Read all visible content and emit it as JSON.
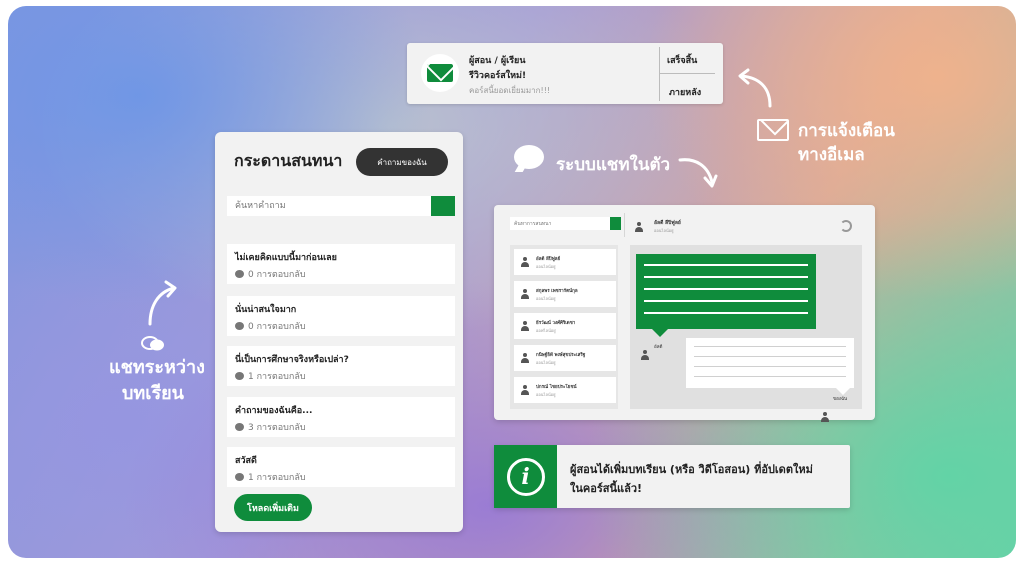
{
  "notification": {
    "from": "ผู้สอน / ผู้เรียน",
    "subject": "รีวิวคอร์สใหม่!",
    "preview": "คอร์สนี้ยอดเยี่ยมมาก!!!",
    "done_label": "เสร็จสิ้น",
    "later_label": "ภายหลัง",
    "icon": "mail-icon"
  },
  "labels": {
    "email_line1": "การแจ้งเตือน",
    "email_line2": "ทางอีเมล",
    "chat_system": "ระบบแชทในตัว",
    "side_line1": "แชทระหว่าง",
    "side_line2": "บทเรียน"
  },
  "board": {
    "title": "กระดานสนทนา",
    "ask_button": "คำถามของฉัน",
    "search_placeholder": "ค้นหาคำถาม",
    "questions": [
      {
        "title": "ไม่เคยคิดแบบนี้มาก่อนเลย",
        "replies": "0 การตอบกลับ"
      },
      {
        "title": "นั่นน่าสนใจมาก",
        "replies": "0 การตอบกลับ"
      },
      {
        "title": "นี่เป็นการศึกษาจริงหรือเปล่า?",
        "replies": "1 การตอบกลับ"
      },
      {
        "title": "คำถามของฉันคือ...",
        "replies": "3 การตอบกลับ"
      },
      {
        "title": "สวัสดี",
        "replies": "1 การตอบกลับ"
      }
    ],
    "load_more": "โหลดเพิ่มเติม"
  },
  "chat": {
    "search_placeholder": "ค้นหาการสนทนา",
    "header_name": "อัลดี ลีปิฟูลย์",
    "header_status": "ออนไลน์อยู่",
    "contacts": [
      {
        "name": "อัลดี ลีปิฟูลย์",
        "status": "ออนไลน์อยู่"
      },
      {
        "name": "สกุลพร เพชรารัตน์กุล",
        "status": "ออนไลน์อยู่"
      },
      {
        "name": "ธีรวัฒน์ วงศ์ศิริเดชา",
        "status": "ออฟไลน์อยู่"
      },
      {
        "name": "กนิษฐ์ธิดี พงษ์สุขประเสริฐ",
        "status": "ออนไลน์อยู่"
      },
      {
        "name": "ปกรณ์ ไชยประโยชน์",
        "status": "ออนไลน์อยู่"
      }
    ],
    "msg_sender": "อัลดี",
    "msg_me": "ของฉัน"
  },
  "info": {
    "line1": "ผู้สอนได้เพิ่มบทเรียน (หรือ วิดีโอสอน) ที่อัปเดตใหม่",
    "line2": "ในคอร์สนี้แล้ว!",
    "icon": "info-icon"
  },
  "colors": {
    "accent_green": "#0f8c3c",
    "dark_button": "#333333",
    "panel": "#f2f2f2"
  }
}
